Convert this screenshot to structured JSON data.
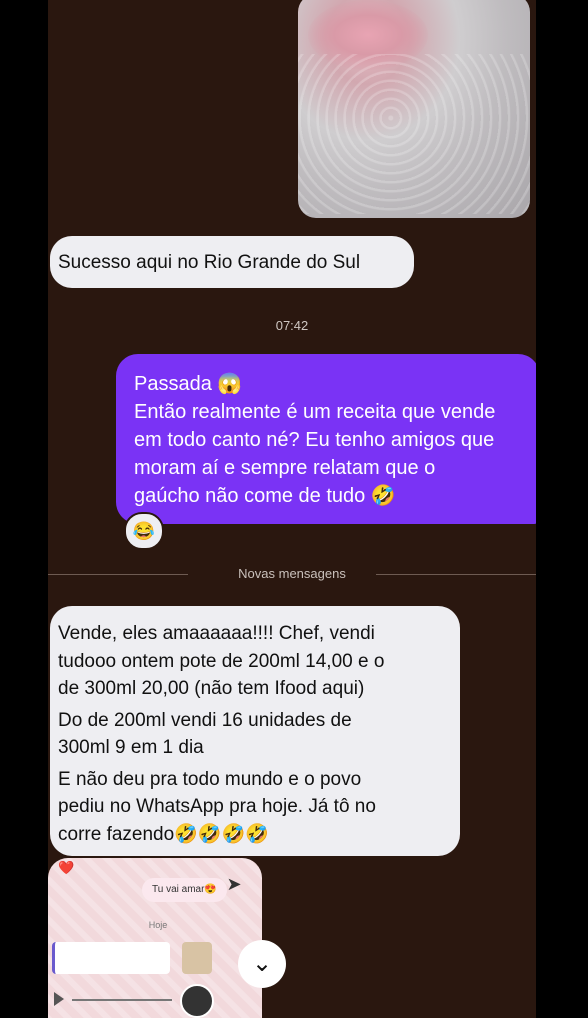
{
  "messages": {
    "incoming_1": "Sucesso aqui no Rio Grande do Sul",
    "timestamp": "07:42",
    "outgoing_lines": [
      "Passada 😱",
      "Então realmente é um receita que vende",
      "em todo canto né? Eu tenho amigos que",
      "moram aí e sempre relatam que o",
      "gaúcho não come de tudo 🤣"
    ],
    "reaction_1": "😂",
    "new_messages_divider": "Novas mensagens",
    "incoming_2_lines": [
      [
        "Vende, eles amaaaaaa!!!! Chef, vendi",
        "tudooo ontem pote de 200ml 14,00 e o",
        "de 300ml 20,00 (não tem Ifood aqui)"
      ],
      [
        "Do de 200ml vendi 16 unidades de",
        "300ml 9 em 1 dia"
      ],
      [
        "E não deu pra todo mundo e o povo",
        "pediu no WhatsApp pra hoje. Já tô no",
        "corre fazendo🤣🤣🤣🤣"
      ]
    ],
    "reaction_2": "❤️"
  },
  "shared_screenshot": {
    "chip_text": "Tu vai amar😍",
    "separator": "Hoje"
  },
  "icons": {
    "reaction": "face-with-tears-of-joy-icon",
    "scroll_down": "chevron-down-icon",
    "share": "forward-arrow-icon"
  },
  "colors": {
    "background": "#2a170f",
    "outgoing_bubble": "#7a33f5",
    "incoming_bubble": "#eeeef2"
  }
}
